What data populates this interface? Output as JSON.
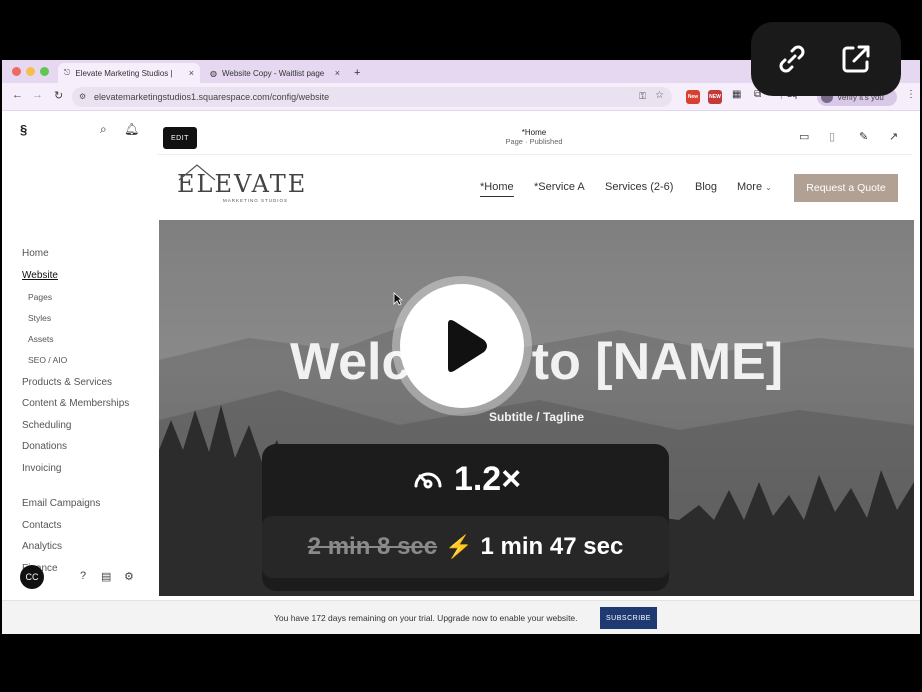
{
  "browser": {
    "tabs": [
      {
        "title": "Elevate Marketing Studios |",
        "favicon": "squarespace-icon"
      },
      {
        "title": "Website Copy - Waitlist page",
        "favicon": "globe-icon"
      }
    ],
    "new_tab": "+",
    "close_glyph": "×",
    "url": "elevatemarketingstudios1.squarespace.com/config/website",
    "profile_label": "Verify it's you",
    "ext_new_1": "New",
    "ext_new_2": "NEW",
    "ext_lq": "Lq"
  },
  "sidebar": {
    "items": [
      {
        "label": "Home"
      },
      {
        "label": "Website"
      },
      {
        "label": "Products & Services"
      },
      {
        "label": "Content & Memberships"
      },
      {
        "label": "Scheduling"
      },
      {
        "label": "Donations"
      },
      {
        "label": "Invoicing"
      },
      {
        "label": "Email Campaigns"
      },
      {
        "label": "Contacts"
      },
      {
        "label": "Analytics"
      },
      {
        "label": "Finance"
      }
    ],
    "subitems": [
      {
        "label": "Pages"
      },
      {
        "label": "Styles"
      },
      {
        "label": "Assets"
      },
      {
        "label": "SEO / AIO"
      }
    ],
    "user_initials": "CC"
  },
  "editor": {
    "edit_label": "EDIT",
    "page_name": "*Home",
    "page_state": "Page · Published"
  },
  "site": {
    "logo_word": "ELEVATE",
    "logo_tagline": "MARKETING STUDIOS",
    "nav": [
      {
        "label": "*Home"
      },
      {
        "label": "*Service A"
      },
      {
        "label": "Services (2-6)"
      },
      {
        "label": "Blog"
      },
      {
        "label": "More"
      }
    ],
    "cta_label": "Request a Quote",
    "hero_title": "Welcome to [NAME]",
    "hero_subtitle": "Subtitle / Tagline"
  },
  "trial": {
    "message": "You have 172 days remaining on your trial. Upgrade now to enable your website.",
    "subscribe_label": "SUBSCRIBE"
  },
  "video": {
    "speed": "1.2×",
    "original_duration": "2 min 8 sec",
    "new_duration": "1 min 47 sec"
  },
  "colors": {
    "accent_button": "#b0a194",
    "subscribe": "#1f3a70",
    "tabbar": "#e5d8f0",
    "bolt": "#f6c04a"
  }
}
